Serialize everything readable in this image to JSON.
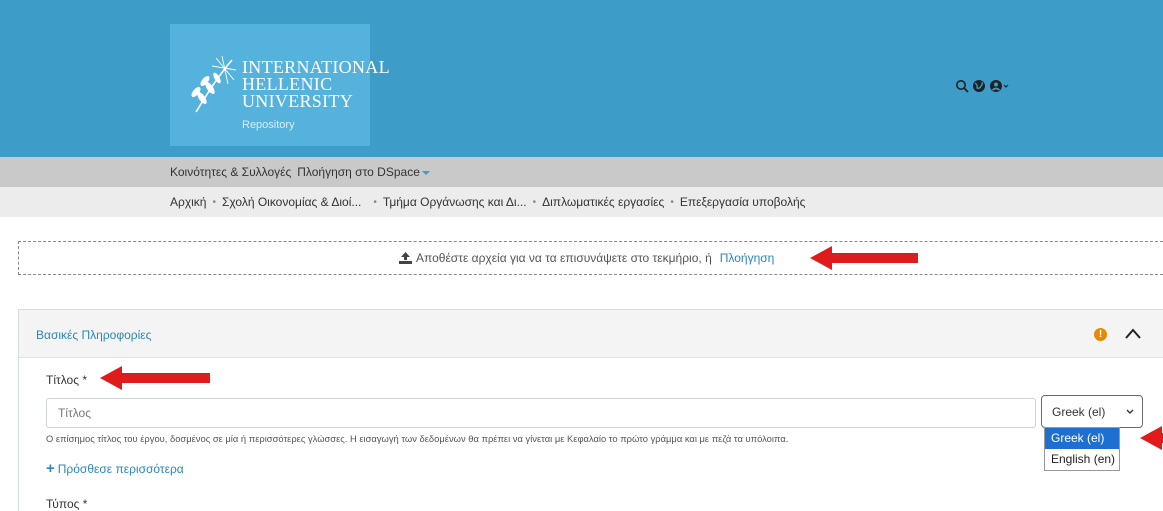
{
  "header": {
    "logo_line1": "INTERNATIONAL",
    "logo_line2": "HELLENIC",
    "logo_line3": "UNIVERSITY",
    "logo_sub": "Repository",
    "icons": [
      "search-icon",
      "globe-icon",
      "user-icon"
    ]
  },
  "nav": {
    "communities": "Κοινότητες & Συλλογές",
    "browse": "Πλοήγηση στο DSpace"
  },
  "breadcrumb": {
    "items": [
      "Αρχική",
      "Σχολή Οικονομίας & Διοί...",
      "Τμήμα Οργάνωσης και Δι...",
      "Διπλωματικές εργασίες",
      "Επεξεργασία υποβολής"
    ]
  },
  "dropzone": {
    "text": "Αποθέστε αρχεία για να τα επισυνάψετε στο τεκμήριο, ή",
    "link": "Πλοήγηση"
  },
  "panel": {
    "title": "Βασικές Πληροφορίες",
    "warning_icon": "!",
    "title_field": {
      "label": "Τίτλος *",
      "placeholder": "Τίτλος",
      "value": "",
      "help": "Ο επίσημος τίτλος του έργου, δοσμένος σε μία ή περισσότερες γλώσσες. Η εισαγωγή των δεδομένων θα πρέπει να γίνεται με Κεφαλαίο το πρώτο γράμμα και με πεζά τα υπόλοιπα."
    },
    "language_select": {
      "selected": "Greek (el)",
      "options": [
        "Greek (el)",
        "English (en)"
      ]
    },
    "add_more": "Πρόσθεσε περισσότερα",
    "type_label": "Τύπος *"
  },
  "colors": {
    "header_bg": "#3d9cc8",
    "logo_bg": "#55b2dd",
    "link": "#2a87b8",
    "annotation_arrow": "#e01b1b",
    "selected_option": "#1f6fd0"
  }
}
